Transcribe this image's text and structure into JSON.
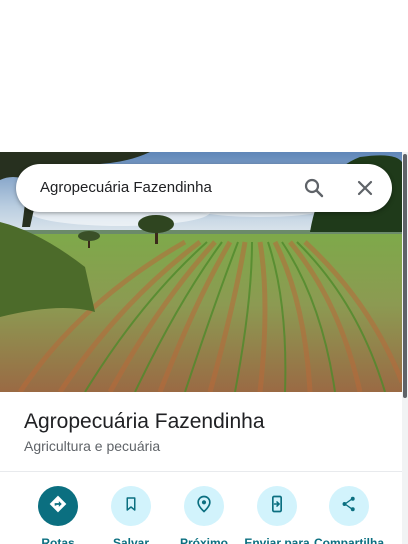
{
  "search": {
    "query": "Agropecuária Fazendinha"
  },
  "place": {
    "name": "Agropecuária Fazendinha",
    "category": "Agricultura e pecuária"
  },
  "actions": [
    {
      "label": "Rotas",
      "icon": "directions-icon"
    },
    {
      "label": "Salvar",
      "icon": "bookmark-icon"
    },
    {
      "label": "Próximo",
      "icon": "nearby-icon"
    },
    {
      "label": "Enviar para",
      "icon": "send-to-phone-icon"
    },
    {
      "label": "Compartilha",
      "icon": "share-icon"
    }
  ],
  "colors": {
    "accent": "#0b6f80",
    "action_bg": "#d2f3fc"
  }
}
